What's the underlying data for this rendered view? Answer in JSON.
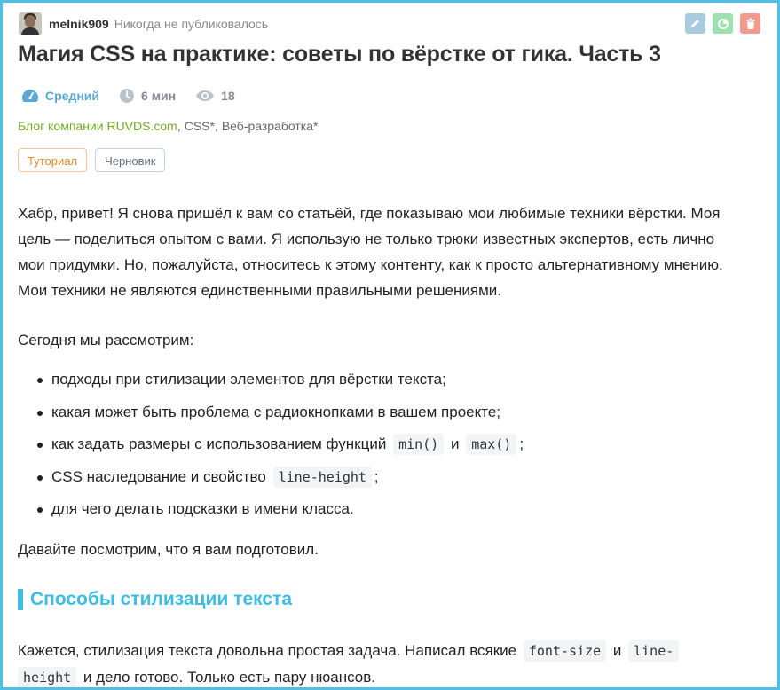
{
  "author": {
    "username": "melnik909",
    "status": "Никогда не публиковалось"
  },
  "actions": {
    "edit_icon": "pencil-icon",
    "stats_icon": "pie-chart-icon",
    "delete_icon": "trash-icon",
    "colors": {
      "edit": "#a9cbe0",
      "stats": "#9fe0b0",
      "delete": "#f39a8f"
    }
  },
  "article": {
    "title": "Магия CSS на практике: советы по вёрстке от гика. Часть 3",
    "meta": {
      "difficulty": "Средний",
      "reading_time": "6 мин",
      "views": "18"
    },
    "hubs": {
      "company": "Блог компании RUVDS.com",
      "tags": [
        "CSS*",
        "Веб-разработка*"
      ],
      "separator": ","
    },
    "badges": {
      "tutorial": "Туториал",
      "draft": "Черновик"
    },
    "intro": "Хабр, привет! Я снова пришёл к вам со статьёй, где показываю мои любимые техники вёрстки. Моя цель — поделиться опытом с вами. Я использую не только трюки известных экспертов, есть лично мои придумки. Но, пожалуйста, относитесь к этому контенту, как к просто альтернативному мнению. Мои техники не являются единственными правильными решениями.",
    "today": "Сегодня мы рассмотрим:",
    "list": {
      "item1": "подходы при стилизации элементов для вёрстки текста;",
      "item2": "какая может быть проблема с радиокнопками в вашем проекте;",
      "item3_a": "как задать размеры с использованием функций",
      "item3_code1": "min()",
      "item3_and": "и",
      "item3_code2": "max()",
      "item3_end": ";",
      "item4_a": "CSS наследование и свойство",
      "item4_code": "line-height",
      "item4_end": ";",
      "item5": "для чего делать подсказки в имени класса."
    },
    "lets_see": "Давайте посмотрим, что я вам подготовил.",
    "section_heading": "Способы стилизации текста",
    "section_p_a": "Кажется, стилизация текста довольна простая задача. Написал всякие",
    "section_p_code1": "font-size",
    "section_p_and": "и",
    "section_p_code2a": "line-",
    "section_p_code2b": "height",
    "section_p_end": "и дело готово. Только есть пару нюансов."
  },
  "colors": {
    "accent": "#3ebde3",
    "company_link": "#73a92a",
    "difficulty": "#5ba8d6",
    "tutorial": "#e08a2a"
  }
}
